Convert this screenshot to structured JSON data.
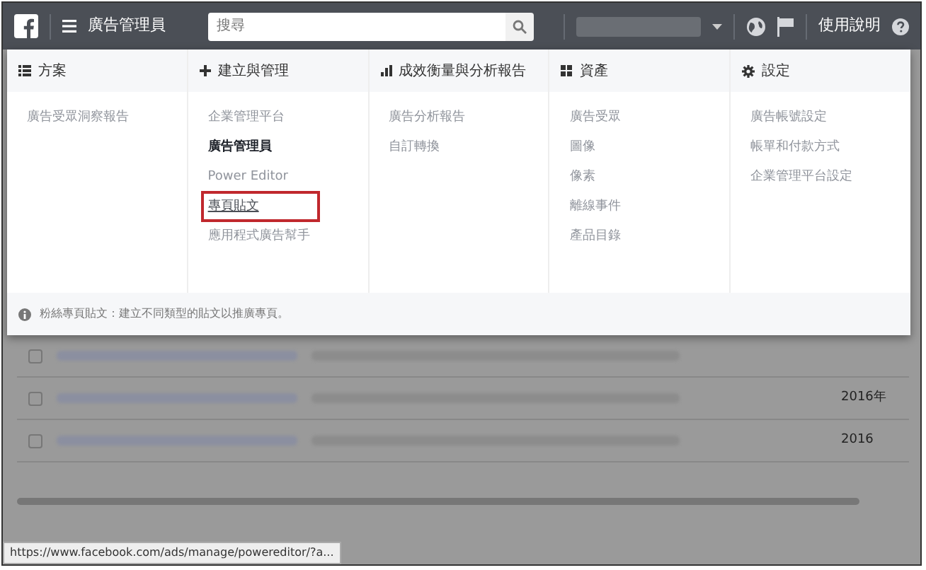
{
  "top_bar": {
    "title": "廣告管理員",
    "search": {
      "placeholder": "搜尋"
    },
    "help": "使用說明"
  },
  "menu": {
    "columns": [
      {
        "heading": "方案",
        "items": [
          {
            "label": "廣告受眾洞察報告",
            "selected": false,
            "highlighted": false
          }
        ]
      },
      {
        "heading": "建立與管理",
        "items": [
          {
            "label": "企業管理平台",
            "selected": false,
            "highlighted": false
          },
          {
            "label": "廣告管理員",
            "selected": true,
            "highlighted": false
          },
          {
            "label": "Power Editor",
            "selected": false,
            "highlighted": false
          },
          {
            "label": "專頁貼文",
            "selected": false,
            "highlighted": true
          },
          {
            "label": "應用程式廣告幫手",
            "selected": false,
            "highlighted": false
          }
        ]
      },
      {
        "heading": "成效衡量與分析報告",
        "items": [
          {
            "label": "廣告分析報告",
            "selected": false,
            "highlighted": false
          },
          {
            "label": "自訂轉換",
            "selected": false,
            "highlighted": false
          }
        ]
      },
      {
        "heading": "資產",
        "items": [
          {
            "label": "廣告受眾",
            "selected": false,
            "highlighted": false
          },
          {
            "label": "圖像",
            "selected": false,
            "highlighted": false
          },
          {
            "label": "像素",
            "selected": false,
            "highlighted": false
          },
          {
            "label": "離線事件",
            "selected": false,
            "highlighted": false
          },
          {
            "label": "產品目錄",
            "selected": false,
            "highlighted": false
          }
        ]
      },
      {
        "heading": "設定",
        "items": [
          {
            "label": "廣告帳號設定",
            "selected": false,
            "highlighted": false
          },
          {
            "label": "帳單和付款方式",
            "selected": false,
            "highlighted": false
          },
          {
            "label": "企業管理平台設定",
            "selected": false,
            "highlighted": false
          }
        ]
      }
    ],
    "info": "粉絲專頁貼文：建立不同類型的貼文以推廣專頁。"
  },
  "background_table": {
    "rows": [
      {
        "checked": false,
        "date": ""
      },
      {
        "checked": false,
        "date": "2016年"
      },
      {
        "checked": false,
        "date": "2016"
      }
    ]
  },
  "status_bar": "https://www.facebook.com/ads/manage/powereditor/?a..."
}
